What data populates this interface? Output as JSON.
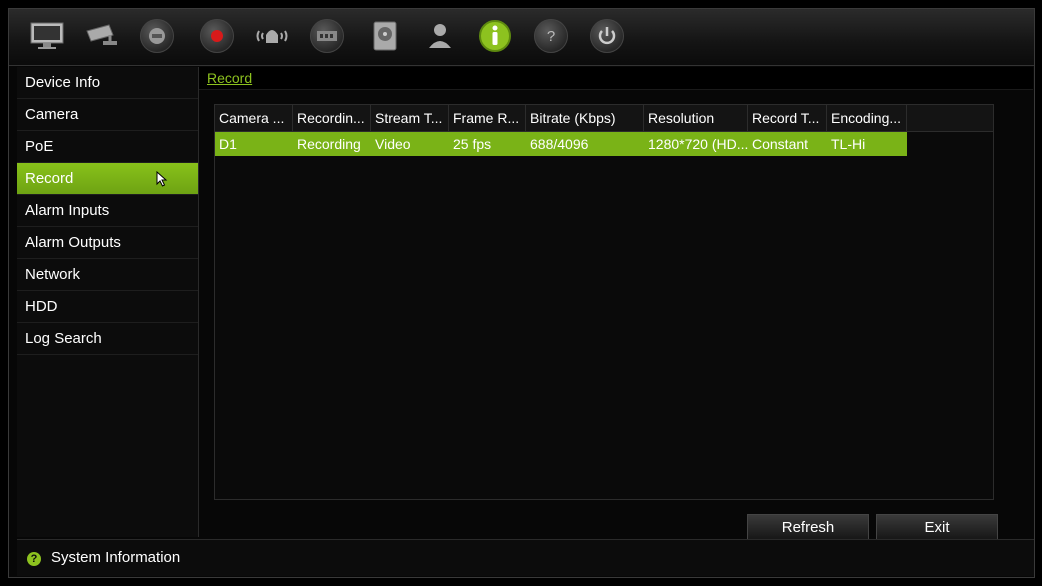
{
  "toolbar": {
    "icons": [
      "monitor-icon",
      "camera-icon",
      "ptz-dome-icon",
      "record-icon",
      "alarm-icon",
      "network-icon",
      "hdd-icon",
      "user-icon",
      "info-icon",
      "help-icon",
      "power-icon"
    ],
    "active": "info-icon",
    "accent": "#8dc21f",
    "record_color": "#d81a1a"
  },
  "sidebar": {
    "items": [
      {
        "label": "Device Info"
      },
      {
        "label": "Camera"
      },
      {
        "label": "PoE"
      },
      {
        "label": "Record"
      },
      {
        "label": "Alarm Inputs"
      },
      {
        "label": "Alarm Outputs"
      },
      {
        "label": "Network"
      },
      {
        "label": "HDD"
      },
      {
        "label": "Log Search"
      }
    ],
    "active_index": 3
  },
  "main": {
    "breadcrumb": "Record",
    "table": {
      "headers": [
        "Camera ...",
        "Recordin...",
        "Stream T...",
        "Frame R...",
        "Bitrate (Kbps)",
        "Resolution",
        "Record T...",
        "Encoding..."
      ],
      "rows": [
        [
          "D1",
          "Recording",
          "Video",
          "25 fps",
          "688/4096",
          "1280*720 (HD...",
          "Constant",
          "TL-Hi"
        ]
      ]
    },
    "buttons": {
      "refresh": "Refresh",
      "exit": "Exit"
    }
  },
  "status_bar": {
    "text": "System Information"
  }
}
